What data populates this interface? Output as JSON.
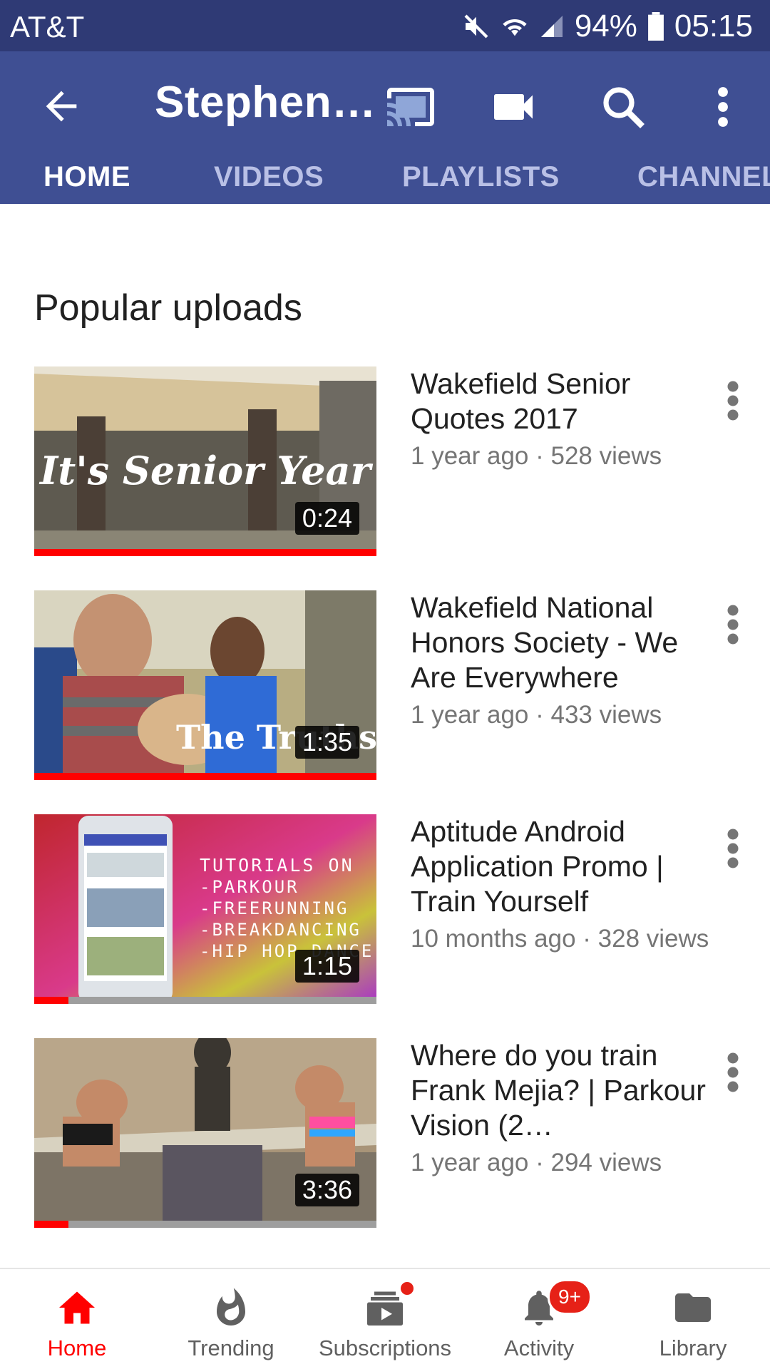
{
  "status_bar": {
    "carrier": "AT&T",
    "battery": "94%",
    "time": "05:15"
  },
  "app_bar": {
    "title": "Stephen…",
    "tabs": [
      {
        "label": "HOME",
        "active": true
      },
      {
        "label": "VIDEOS",
        "active": false
      },
      {
        "label": "PLAYLISTS",
        "active": false
      },
      {
        "label": "CHANNEL",
        "active": false
      }
    ]
  },
  "section": {
    "title": "Popular uploads"
  },
  "videos": [
    {
      "title": "Wakefield Senior Quotes 2017",
      "meta": "1 year ago · 528 views",
      "duration": "0:24",
      "watched_fraction": 1.0,
      "thumb_text": "It's Senior Year"
    },
    {
      "title": "Wakefield National Honors Society - We Are Everywhere",
      "meta": "1 year ago · 433 views",
      "duration": "1:35",
      "watched_fraction": 1.0,
      "thumb_text": "The Truths"
    },
    {
      "title": "Aptitude Android Application Promo | Train Yourself",
      "meta": "10 months ago · 328 views",
      "duration": "1:15",
      "watched_fraction": 0.1,
      "thumb_text": "TUTORIALS ON -PARKOUR -FREERUNNING -BREAKDANCING -HIP HOP DANCE"
    },
    {
      "title": "Where do you train Frank Mejia? | Parkour Vision (2…",
      "meta": "1 year ago · 294 views",
      "duration": "3:36",
      "watched_fraction": 0.1,
      "thumb_text": ""
    }
  ],
  "bottom_nav": {
    "items": [
      {
        "label": "Home",
        "icon": "home-icon",
        "active": true
      },
      {
        "label": "Trending",
        "icon": "flame-icon",
        "active": false
      },
      {
        "label": "Subscriptions",
        "icon": "subscriptions-icon",
        "active": false
      },
      {
        "label": "Activity",
        "icon": "bell-icon",
        "active": false,
        "badge": "9+"
      },
      {
        "label": "Library",
        "icon": "folder-icon",
        "active": false
      }
    ]
  },
  "colors": {
    "app_bar": "#3f4f93",
    "status_bar": "#2f3a75",
    "accent": "#ff0000"
  }
}
